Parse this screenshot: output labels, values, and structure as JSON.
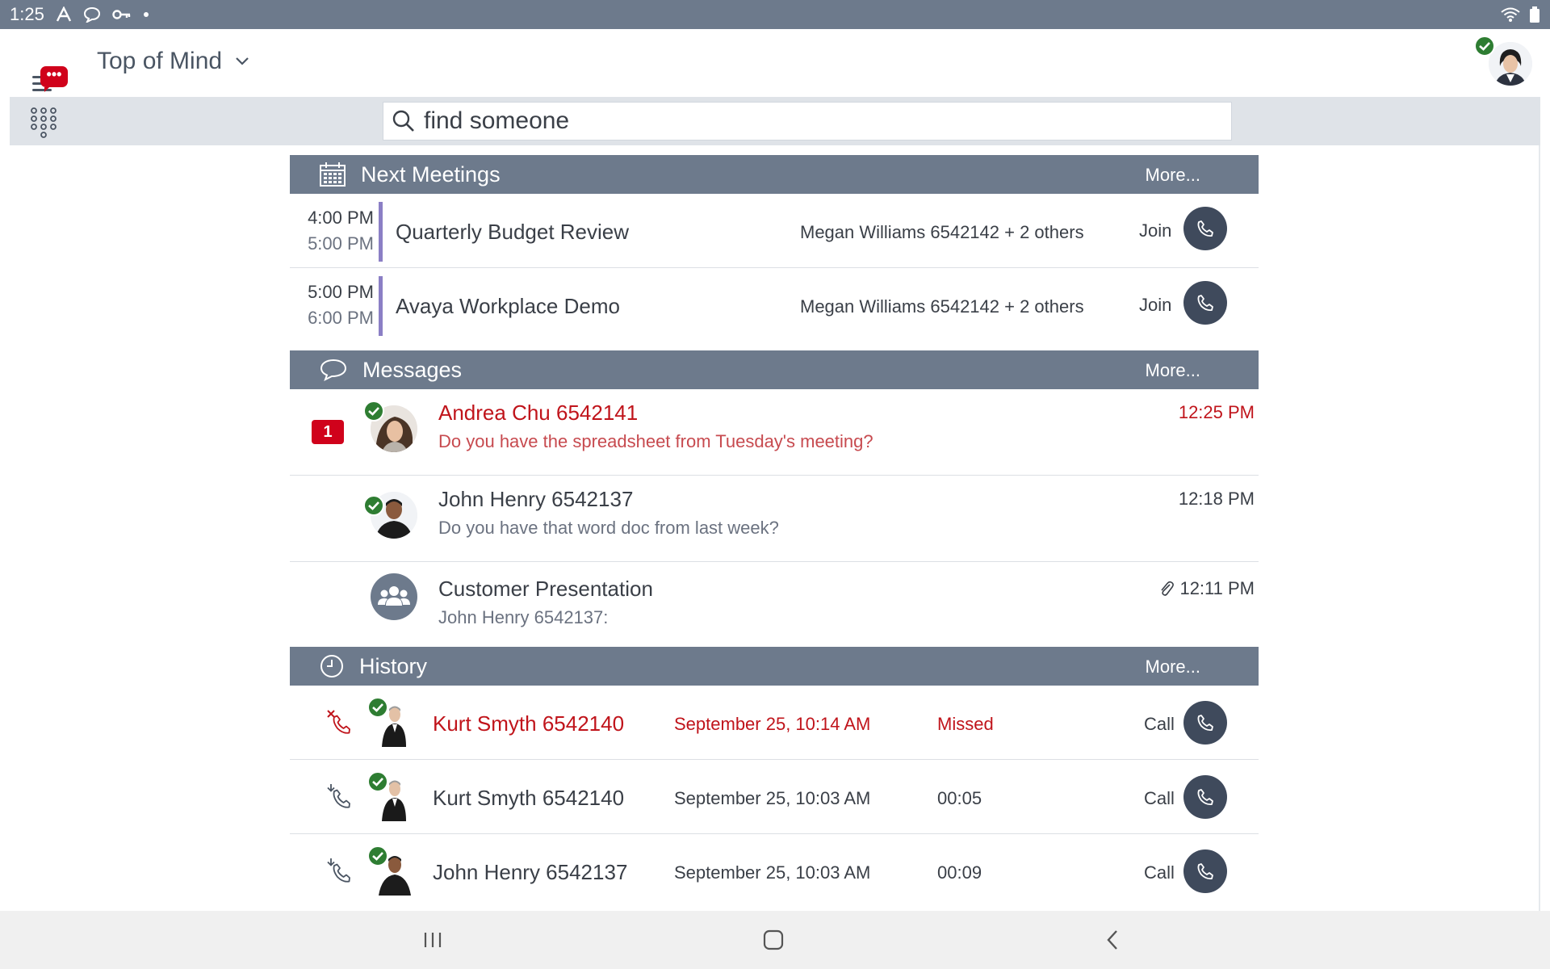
{
  "status_bar": {
    "time": "1:25"
  },
  "header": {
    "title": "Top of Mind",
    "menu_badge": "•••"
  },
  "search": {
    "placeholder": "find someone",
    "value": ""
  },
  "meetings": {
    "title": "Next Meetings",
    "more": "More...",
    "items": [
      {
        "start": "4:00 PM",
        "end": "5:00 PM",
        "title": "Quarterly Budget Review",
        "participants": "Megan Williams 6542142 + 2 others",
        "join": "Join"
      },
      {
        "start": "5:00 PM",
        "end": "6:00 PM",
        "title": "Avaya Workplace Demo",
        "participants": "Megan Williams 6542142 + 2 others",
        "join": "Join"
      }
    ]
  },
  "messages": {
    "title": "Messages",
    "more": "More...",
    "items": [
      {
        "unread_count": "1",
        "name": "Andrea Chu 6542141",
        "text": "Do you have the spreadsheet from Tuesday's meeting?",
        "time": "12:25 PM"
      },
      {
        "name": "John Henry 6542137",
        "text": "Do you have that word doc from last week?",
        "time": "12:18 PM"
      },
      {
        "name": "Customer Presentation",
        "text": "John Henry 6542137:",
        "time": "12:11 PM"
      }
    ]
  },
  "history": {
    "title": "History",
    "more": "More...",
    "items": [
      {
        "name": "Kurt Smyth 6542140",
        "date": "September 25, 10:14 AM",
        "status": "Missed",
        "call": "Call"
      },
      {
        "name": "Kurt Smyth 6542140",
        "date": "September 25, 10:03 AM",
        "status": "00:05",
        "call": "Call"
      },
      {
        "name": "John Henry 6542137",
        "date": "September 25, 10:03 AM",
        "status": "00:09",
        "call": "Call"
      }
    ]
  },
  "colors": {
    "accent": "#6d7a8c",
    "alert": "#d0021b",
    "presence": "#2e7d32",
    "meeting_stripe": "#8b7fc5"
  }
}
